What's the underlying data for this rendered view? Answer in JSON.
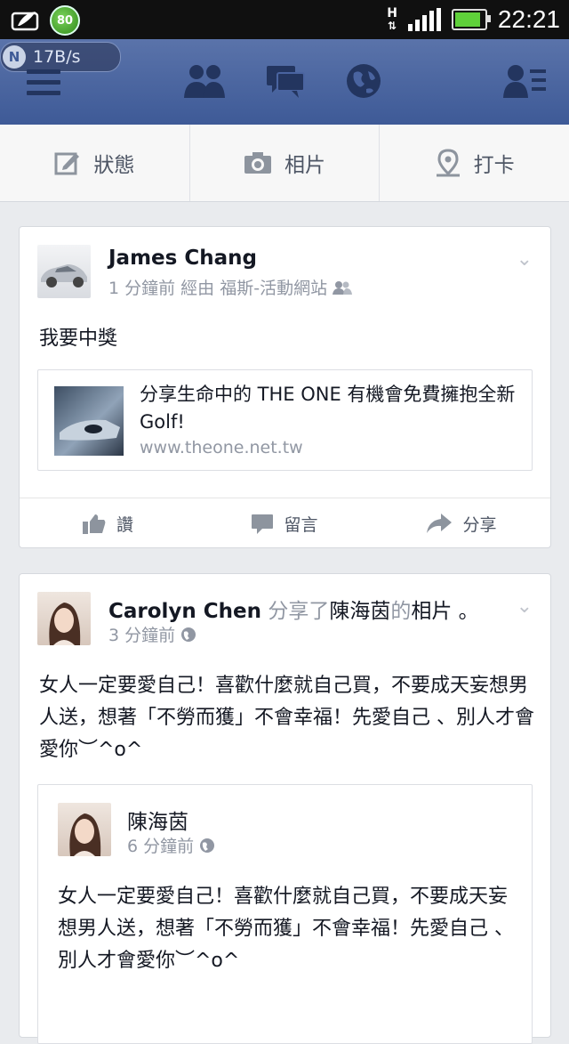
{
  "status_bar": {
    "battery_badge": "80",
    "time": "22:21",
    "network": "H"
  },
  "top_bar": {
    "data_speed": "17B/s",
    "speed_badge": "N"
  },
  "composer": {
    "status_label": "狀態",
    "photo_label": "相片",
    "checkin_label": "打卡"
  },
  "post1": {
    "author": "James Chang",
    "meta": "1 分鐘前 經由 福斯-活動網站",
    "text": "我要中獎",
    "link": {
      "title": "分享生命中的 THE ONE 有機會免費擁抱全新Golf!",
      "url": "www.theone.net.tw"
    },
    "actions": {
      "like": "讚",
      "comment": "留言",
      "share": "分享"
    }
  },
  "post2": {
    "author": "Carolyn Chen",
    "shared_prefix": "分享了",
    "shared_name": "陳海茵",
    "shared_of": "的",
    "shared_object": "相片",
    "shared_suffix": "。",
    "meta": "3 分鐘前",
    "text": "女人一定要愛自己！喜歡什麼就自己買，不要成天妄想男人送，想著「不勞而獲」不會幸福！先愛自己 、別人才會愛你︶^o^",
    "shared_post": {
      "author": "陳海茵",
      "meta": "6 分鐘前",
      "text": "女人一定要愛自己！喜歡什麼就自己買，不要成天妄想男人送，想著「不勞而獲」不會幸福！先愛自己 、別人才會愛你︶^o^"
    }
  },
  "colors": {
    "brand": "#3e5a97",
    "background": "#e9ebee",
    "meta_text": "#9197a3"
  }
}
